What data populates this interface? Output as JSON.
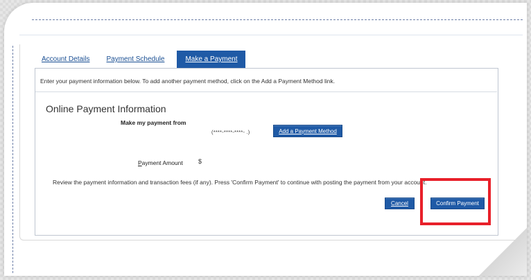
{
  "tabs": [
    {
      "label": "Account Details",
      "active": false
    },
    {
      "label": "Payment Schedule",
      "active": false
    },
    {
      "label": "Make a Payment",
      "active": true
    }
  ],
  "instructions": "Enter your payment information below. To add another payment method, click on the Add a Payment Method link.",
  "section_title": "Online Payment Information",
  "payment_from": {
    "label": "Make my payment from",
    "masked_account": "(****-****-****-      .)",
    "add_method_label": "Add a Payment Method"
  },
  "payment_amount": {
    "label_first_letter": "P",
    "label_rest": "ayment Amount",
    "currency_symbol": "$"
  },
  "review_text": "Review the payment information and transaction fees (if any). Press 'Confirm Payment' to continue with posting the payment from your account.",
  "actions": {
    "cancel_label": "Cancel",
    "confirm_label": "Confirm Payment"
  },
  "colors": {
    "accent": "#1f5aa6",
    "highlight": "#e8202a"
  }
}
